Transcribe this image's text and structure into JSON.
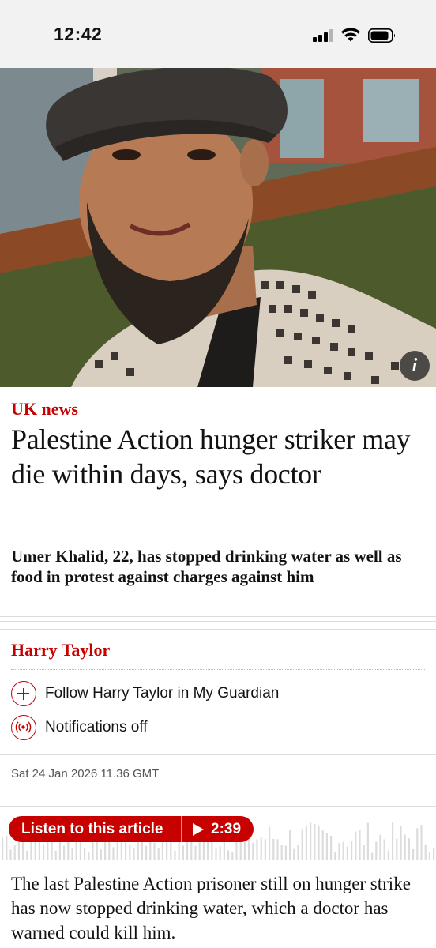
{
  "status_bar": {
    "time": "12:42",
    "icons": [
      "cellular-signal-icon",
      "wifi-icon",
      "battery-icon"
    ]
  },
  "hero": {
    "image": "photo of bearded man in flat cap and keffiyeh scarf",
    "info_icon_glyph": "i"
  },
  "article": {
    "section": "UK news",
    "headline": "Palestine Action hunger striker may die within days, says doctor",
    "standfirst": "Umer Khalid, 22, has stopped drinking water as well as food in protest against charges against him",
    "byline": "Harry Taylor",
    "follow_label": "Follow Harry Taylor in My Guardian",
    "notifications_label": "Notifications off",
    "timestamp": "Sat 24 Jan 2026 11.36 GMT",
    "body_first_paragraph": "The last Palestine Action prisoner still on hunger strike has now stopped drinking water, which a doctor has warned could kill him."
  },
  "audio": {
    "listen_label": "Listen to this article",
    "duration": "2:39"
  },
  "colors": {
    "accent_red": "#c70000",
    "text": "#121212",
    "status_bar_bg": "#f2f2f2"
  }
}
